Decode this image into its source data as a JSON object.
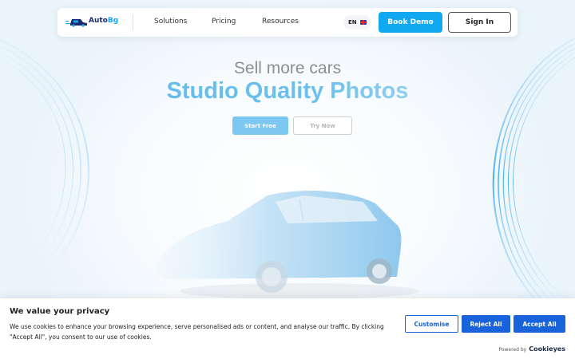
{
  "nav": {
    "logo_text_a": "Auto",
    "logo_text_b": "Bg",
    "links": [
      "Solutions",
      "Pricing",
      "Resources"
    ],
    "language": "EN",
    "book_demo": "Book Demo",
    "sign_in": "Sign In"
  },
  "hero": {
    "subtitle": "Sell more cars",
    "title": "Studio Quality Photos",
    "start_free": "Start Free",
    "try_now": "Try Now"
  },
  "cookie": {
    "title": "We value your privacy",
    "text": "We use cookies to enhance your browsing experience, serve personalised ads or content, and analyse our traffic. By clicking \"Accept All\", you consent to our use of cookies.",
    "customise": "Customise",
    "reject_all": "Reject All",
    "accept_all": "Accept All",
    "powered_by": "Powered by",
    "brand": "Cookieyes"
  },
  "colors": {
    "accent": "#11a8f2",
    "cookie_button": "#1863dc",
    "brand_dark": "#1a2a6b"
  },
  "icons": [
    "logo-mark-icon",
    "uk-flag-icon",
    "car-image"
  ]
}
